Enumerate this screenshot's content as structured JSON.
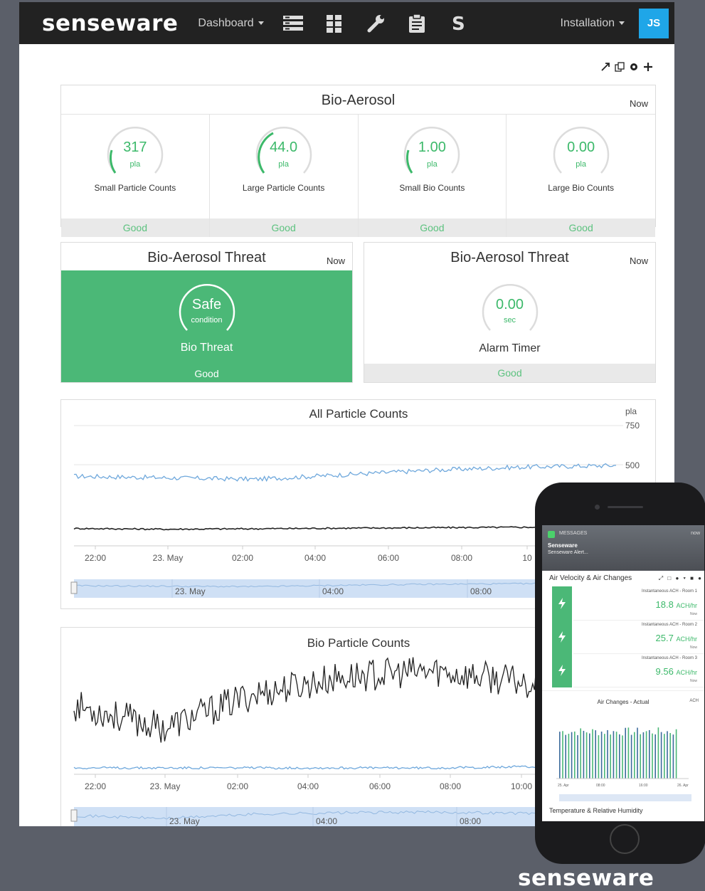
{
  "app": {
    "logo": "senseware",
    "nav_dashboard": "Dashboard",
    "nav_installation": "Installation",
    "avatar_initials": "JS",
    "icons": [
      "list-icon",
      "grid-icon",
      "wrench-icon",
      "clipboard-icon",
      "s-icon"
    ],
    "accent_color": "#1fa6e8",
    "good_color": "#4bb877"
  },
  "bio_aerosol": {
    "title": "Bio-Aerosol",
    "now": "Now",
    "cells": [
      {
        "value": "317",
        "unit": "pla",
        "label": "Small Particle Counts",
        "status": "Good"
      },
      {
        "value": "44.0",
        "unit": "pla",
        "label": "Large Particle Counts",
        "status": "Good"
      },
      {
        "value": "1.00",
        "unit": "pla",
        "label": "Small Bio Counts",
        "status": "Good"
      },
      {
        "value": "0.00",
        "unit": "pla",
        "label": "Large Bio Counts",
        "status": "Good"
      }
    ]
  },
  "threat_left": {
    "title": "Bio-Aerosol Threat",
    "now": "Now",
    "value": "Safe",
    "unit": "condition",
    "label": "Bio Threat",
    "status": "Good"
  },
  "threat_right": {
    "title": "Bio-Aerosol Threat",
    "now": "Now",
    "value": "0.00",
    "unit": "sec",
    "label": "Alarm Timer",
    "status": "Good"
  },
  "all_particles": {
    "title": "All Particle Counts",
    "unit": "pla",
    "y750": "750",
    "y500": "500",
    "x_ticks": [
      "22:00",
      "23. May",
      "02:00",
      "04:00",
      "06:00",
      "08:00",
      "10"
    ],
    "nav_ticks": [
      "23. May",
      "04:00",
      "08:00"
    ]
  },
  "bio_particles": {
    "title": "Bio Particle Counts",
    "x_ticks": [
      "22:00",
      "23. May",
      "02:00",
      "04:00",
      "06:00",
      "08:00",
      "10:00"
    ],
    "nav_ticks": [
      "23. May",
      "04:00",
      "08:00"
    ]
  },
  "phone": {
    "notif_app": "MESSAGES",
    "notif_time": "now",
    "notif_title": "Senseware",
    "notif_body": "Senseware Alert...",
    "panel_title": "Air Velocity & Air Changes",
    "rows": [
      {
        "label": "Instantaneous ACH - Room 1",
        "value": "18.8",
        "unit": "ACH/hr",
        "now": "Now"
      },
      {
        "label": "Instantaneous ACH - Room 2",
        "value": "25.7",
        "unit": "ACH/hr",
        "now": "Now"
      },
      {
        "label": "Instantaneous ACH - Room 3",
        "value": "9.56",
        "unit": "ACH/hr",
        "now": "Now"
      }
    ],
    "chart_title": "Air Changes - Actual",
    "chart_unit": "ACH",
    "chart_x": [
      "25. Apr",
      "08:00",
      "16:00",
      "26. Apr"
    ],
    "footer": "Temperature & Relative Humidity"
  },
  "footer_logo": "senseware",
  "chart_data": [
    {
      "type": "line",
      "title": "All Particle Counts",
      "ylabel": "pla",
      "ylim": [
        0,
        750
      ],
      "x": [
        "22:00",
        "23. May",
        "02:00",
        "04:00",
        "06:00",
        "08:00",
        "10:00"
      ],
      "series": [
        {
          "values": [
            430,
            420,
            410,
            440,
            470,
            490,
            500
          ],
          "color": "#6fa8dc"
        },
        {
          "values": [
            90,
            85,
            88,
            92,
            95,
            98,
            100
          ],
          "color": "#222222"
        }
      ]
    },
    {
      "type": "line",
      "title": "Bio Particle Counts",
      "x": [
        "22:00",
        "23. May",
        "02:00",
        "04:00",
        "06:00",
        "08:00",
        "10:00"
      ],
      "series": [
        {
          "values": [
            60,
            40,
            70,
            85,
            90,
            80,
            95
          ],
          "color": "#222222"
        },
        {
          "values": [
            5,
            5,
            5,
            5,
            5,
            6,
            6
          ],
          "color": "#6fa8dc"
        }
      ]
    }
  ]
}
